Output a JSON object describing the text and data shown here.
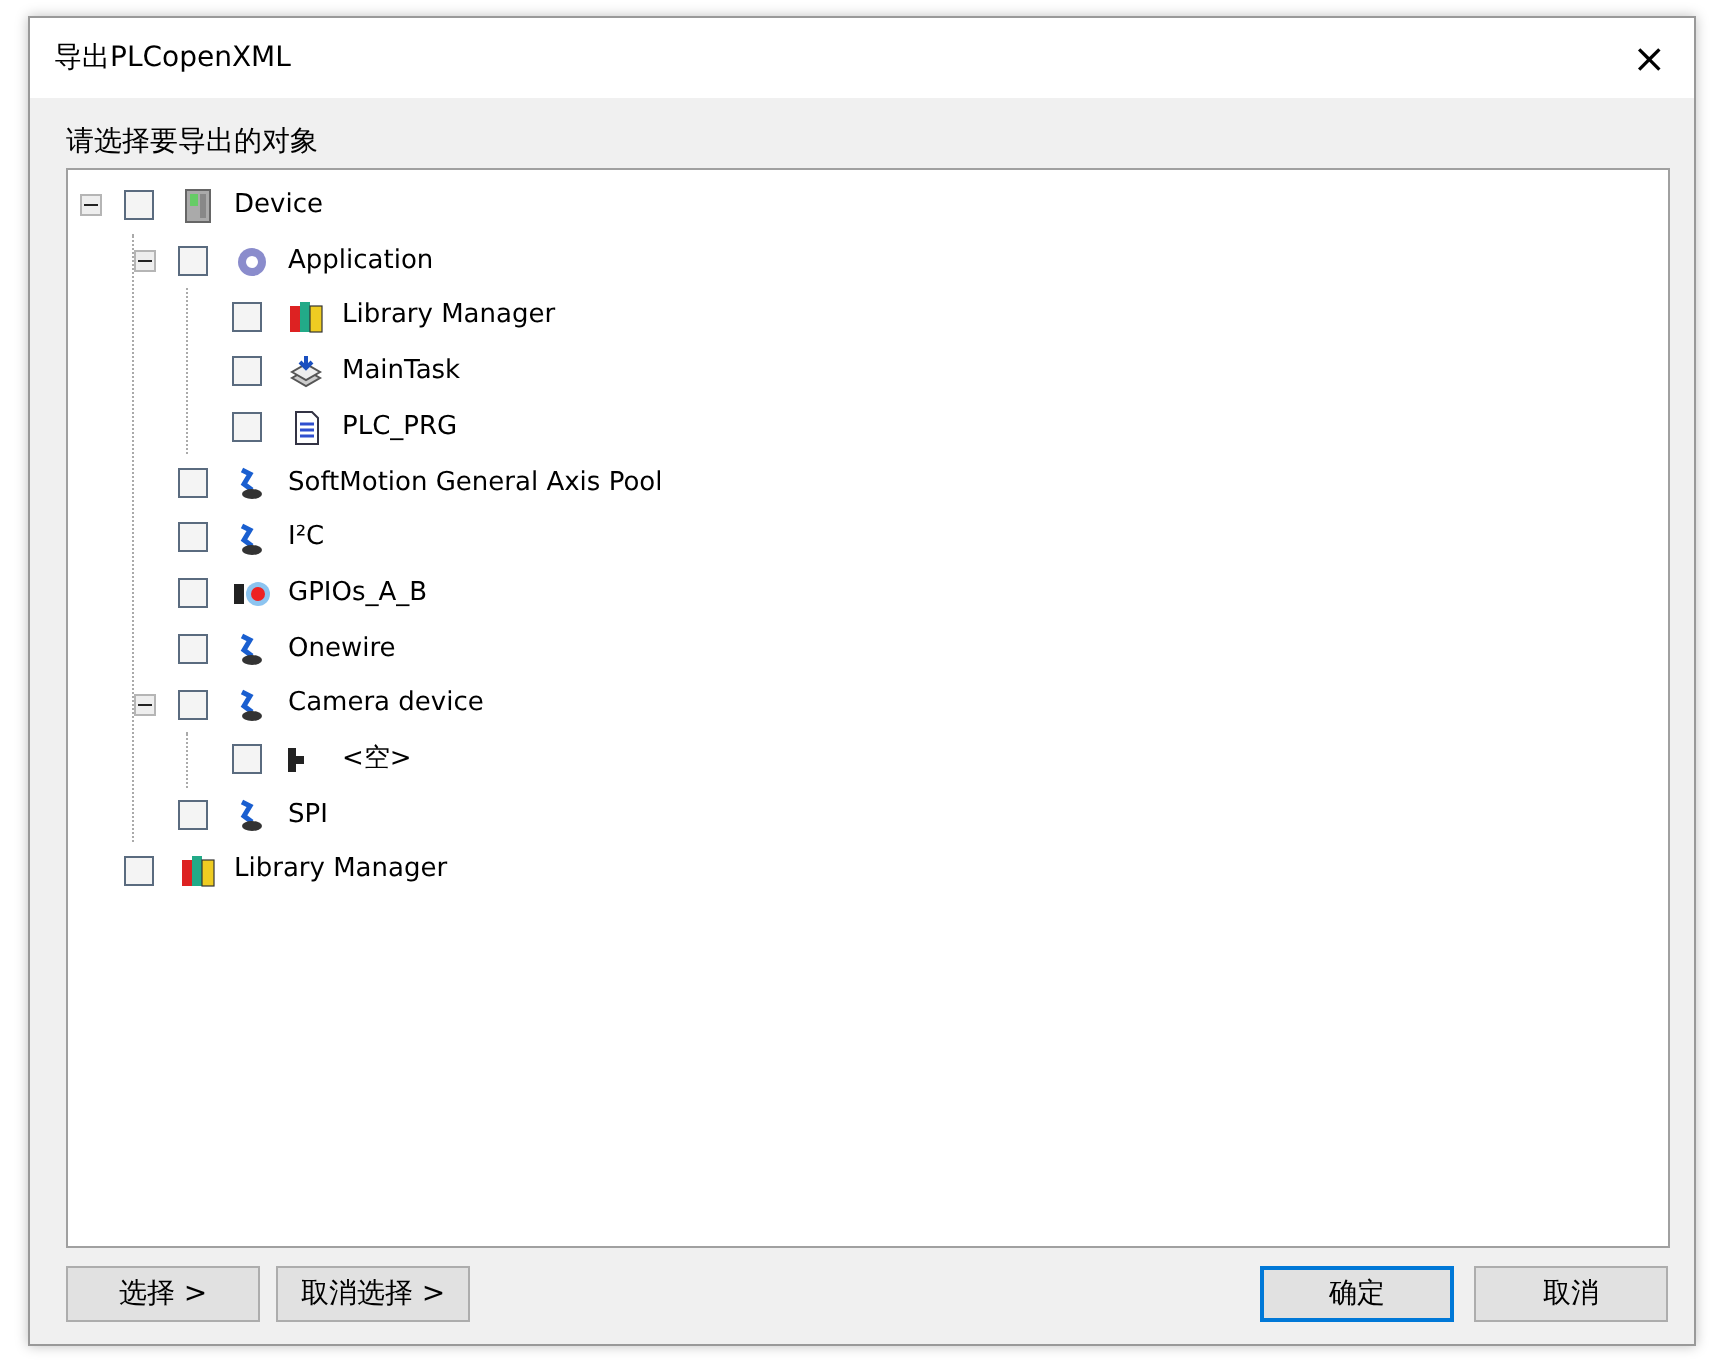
{
  "window": {
    "title": "导出PLCopenXML",
    "close": "×"
  },
  "prompt": "请选择要导出的对象",
  "tree": [
    {
      "label": "Device",
      "kind": "device",
      "checked": false,
      "expanded": true,
      "children": [
        {
          "label": "Application",
          "kind": "application",
          "checked": false,
          "expanded": true,
          "children": [
            {
              "label": "Library Manager",
              "kind": "library",
              "checked": false
            },
            {
              "label": "MainTask",
              "kind": "task",
              "checked": false
            },
            {
              "label": "PLC_PRG",
              "kind": "pou",
              "checked": false
            }
          ]
        },
        {
          "label": "SoftMotion General Axis Pool",
          "kind": "axis",
          "checked": false
        },
        {
          "label": "I²C",
          "kind": "axis",
          "checked": false
        },
        {
          "label": "GPIOs_A_B",
          "kind": "gpio",
          "checked": false
        },
        {
          "label": "Onewire",
          "kind": "axis",
          "checked": false
        },
        {
          "label": "Camera device",
          "kind": "axis",
          "checked": false,
          "expanded": true,
          "children": [
            {
              "label": "<空>",
              "kind": "connector",
              "checked": false
            }
          ]
        },
        {
          "label": "SPI",
          "kind": "axis",
          "checked": false
        }
      ]
    },
    {
      "label": "Library Manager",
      "kind": "library",
      "checked": false
    }
  ],
  "buttons_left": [
    "选择 >",
    "取消选择 >"
  ],
  "buttons_right": [
    {
      "label": "确定",
      "default": true
    },
    {
      "label": "取消",
      "default": false
    }
  ]
}
